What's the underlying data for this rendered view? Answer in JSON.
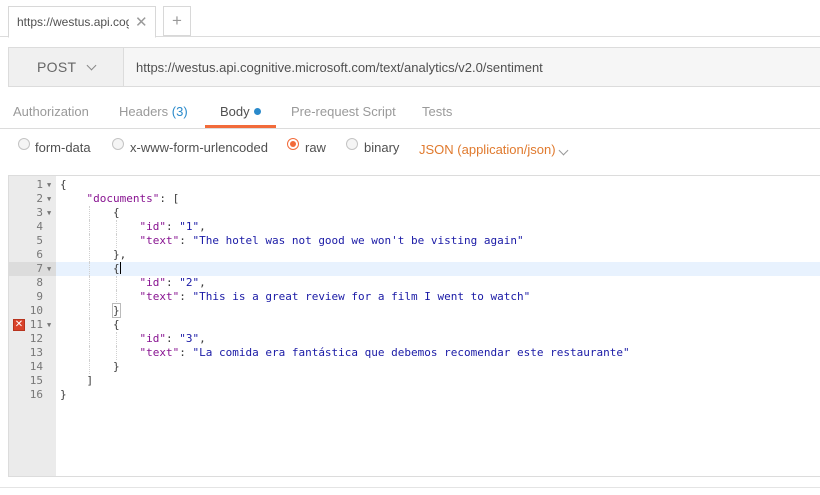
{
  "tab": {
    "title": "https://westus.api.cog",
    "close": "✕",
    "new_tab": "+"
  },
  "request": {
    "method": "POST",
    "url": "https://westus.api.cognitive.microsoft.com/text/analytics/v2.0/sentiment"
  },
  "subtabs": {
    "authorization": "Authorization",
    "headers": "Headers",
    "headers_count": "(3)",
    "body": "Body",
    "prerequest": "Pre-request Script",
    "tests": "Tests"
  },
  "body_modes": {
    "form_data": "form-data",
    "urlencoded": "x-www-form-urlencoded",
    "raw": "raw",
    "binary": "binary",
    "selected": "raw",
    "content_type": "JSON (application/json)"
  },
  "editor": {
    "active_line": 7,
    "error_line": 11,
    "lines": [
      {
        "n": "1",
        "text": "{"
      },
      {
        "n": "2",
        "text": "    \"documents\": ["
      },
      {
        "n": "3",
        "text": "        {"
      },
      {
        "n": "4",
        "text": "            \"id\": \"1\","
      },
      {
        "n": "5",
        "text": "            \"text\": \"The hotel was not good we won't be visting again\""
      },
      {
        "n": "6",
        "text": "        },"
      },
      {
        "n": "7",
        "text": "        {"
      },
      {
        "n": "8",
        "text": "            \"id\": \"2\","
      },
      {
        "n": "9",
        "text": "            \"text\": \"This is a great review for a film I went to watch\""
      },
      {
        "n": "10",
        "text": "        }"
      },
      {
        "n": "11",
        "text": "        {"
      },
      {
        "n": "12",
        "text": "            \"id\": \"3\","
      },
      {
        "n": "13",
        "text": "            \"text\": \"La comida era fantástica que debemos recomendar este restaurante\""
      },
      {
        "n": "14",
        "text": "        }"
      },
      {
        "n": "15",
        "text": "    ]"
      },
      {
        "n": "16",
        "text": "}"
      }
    ]
  },
  "colors": {
    "accent": "#f26b3a",
    "dot": "#2a8acb",
    "content_type": "#e07a2e",
    "json_key": "#881391",
    "json_string": "#1a1aa6",
    "error": "#d9432b"
  }
}
